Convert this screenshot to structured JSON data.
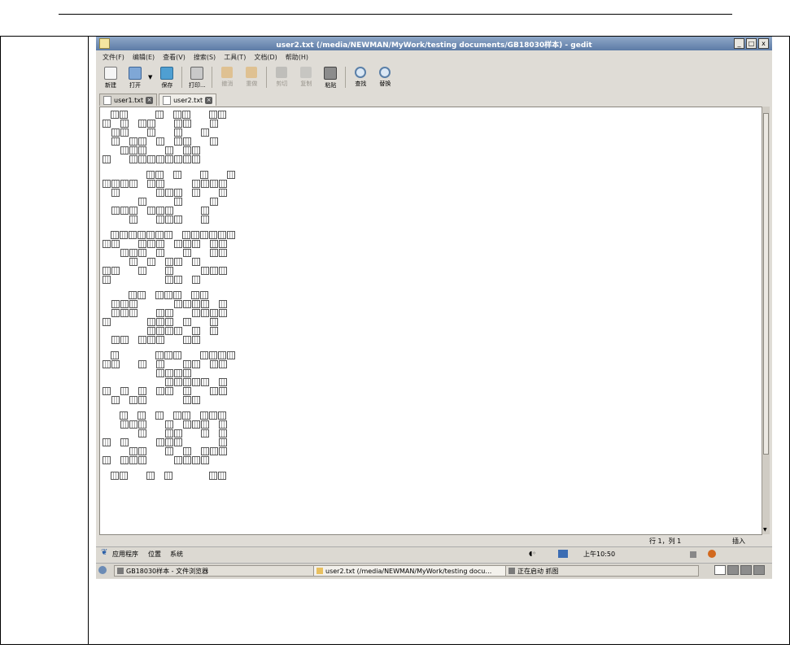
{
  "window": {
    "title": "user2.txt (/media/NEWMAN/MyWork/testing documents/GB18030样本) - gedit",
    "buttons": [
      "_",
      "□",
      "x"
    ]
  },
  "menu": [
    "文件(F)",
    "编辑(E)",
    "查看(V)",
    "搜索(S)",
    "工具(T)",
    "文档(D)",
    "帮助(H)"
  ],
  "toolbar": {
    "new": "新建",
    "open": "打开",
    "save": "保存",
    "print": "打印...",
    "undo": "撤消",
    "redo": "重做",
    "cut": "剪切",
    "copy": "复制",
    "paste": "粘贴",
    "find": "查找",
    "replace": "替换"
  },
  "tabs": [
    {
      "label": "user1.txt"
    },
    {
      "label": "user2.txt"
    }
  ],
  "status": {
    "position": "行 1，列 1",
    "mode": "插入"
  },
  "top_panel": {
    "applications": "应用程序",
    "places": "位置",
    "system": "系统",
    "clock": "上午10:50"
  },
  "taskbar": {
    "item1": "GB18030样本 - 文件浏览器",
    "item2": "user2.txt (/media/NEWMAN/MyWork/testing docu…",
    "item3": "正在启动 抓图"
  },
  "colors": {
    "titlebar": "#6f8cb3",
    "panel": "#dcd9d2"
  }
}
